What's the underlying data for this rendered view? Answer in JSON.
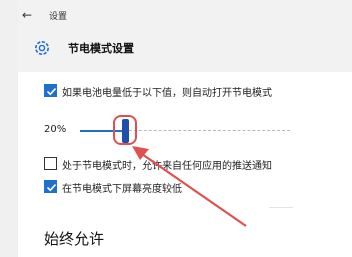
{
  "header": {
    "app_title": "设置",
    "page_title": "节电模式设置",
    "back_icon": "back-arrow-icon",
    "settings_icon": "gear-icon"
  },
  "options": {
    "auto_battery_saver": {
      "label": "如果电池电量低于以下值，则自动打开节电模式",
      "checked": true
    },
    "threshold": {
      "value_text": "20%",
      "value": 20
    },
    "allow_push_notifications": {
      "label": "处于节电模式时，允许来自任何应用的推送通知",
      "checked": false
    },
    "lower_brightness": {
      "label": "在节电模式下屏幕亮度较低",
      "checked": true
    }
  },
  "section": {
    "title": "始终允许"
  },
  "colors": {
    "accent": "#1f6fd1",
    "annotation": "#e05050"
  }
}
